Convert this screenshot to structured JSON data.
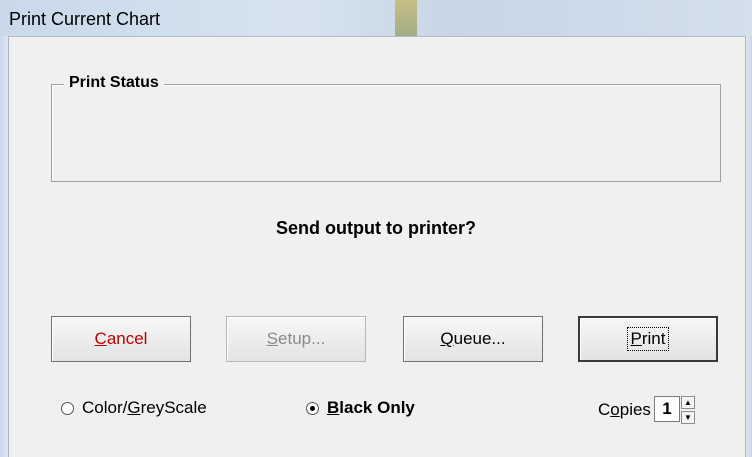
{
  "window": {
    "title": "Print Current Chart"
  },
  "status_group": {
    "legend": "Print Status",
    "text": ""
  },
  "prompt": "Send output to printer?",
  "buttons": {
    "cancel": {
      "pre": "",
      "accel": "C",
      "post": "ancel"
    },
    "setup": {
      "pre": "",
      "accel": "S",
      "post": "etup..."
    },
    "queue": {
      "pre": "",
      "accel": "Q",
      "post": "ueue..."
    },
    "print": {
      "pre": "",
      "accel": "P",
      "post": "rint"
    }
  },
  "color_mode": {
    "options": [
      {
        "pre": "Color/",
        "accel": "G",
        "post": "reyScale",
        "checked": false
      },
      {
        "pre": "",
        "accel": "B",
        "post": "lack Only",
        "checked": true
      }
    ]
  },
  "copies": {
    "label_pre": "C",
    "label_accel": "o",
    "label_post": "pies",
    "value": "1"
  },
  "colors": {
    "cancel_text": "#c00000",
    "disabled_text": "#8a8a8a"
  }
}
